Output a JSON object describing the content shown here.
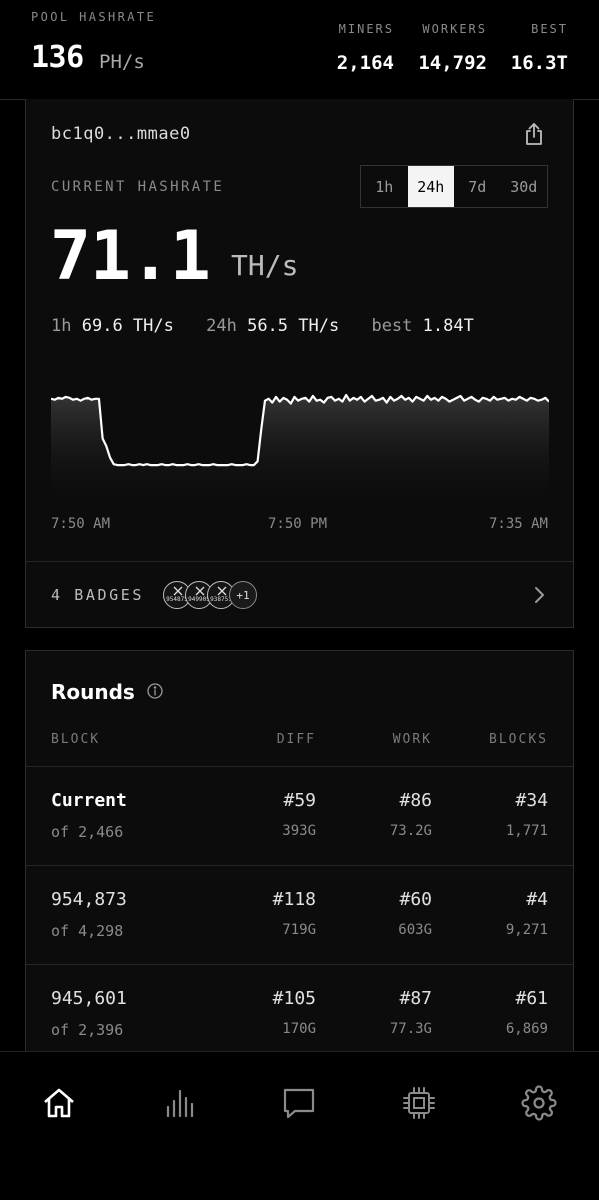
{
  "pool": {
    "label": "POOL HASHRATE",
    "value": "136",
    "unit": "PH/s",
    "stats": [
      {
        "label": "MINERS",
        "value": "2,164"
      },
      {
        "label": "WORKERS",
        "value": "14,792"
      },
      {
        "label": "BEST",
        "value": "16.3T"
      }
    ]
  },
  "miner": {
    "address": "bc1q0...mmae0",
    "share_icon": "share-icon",
    "current_label": "CURRENT HASHRATE",
    "ranges": [
      "1h",
      "24h",
      "7d",
      "30d"
    ],
    "active_range": "24h",
    "hashrate": "71.1",
    "hashrate_unit": "TH/s",
    "sub": {
      "h1_label": "1h",
      "h1_value": "69.6 TH/s",
      "h24_label": "24h",
      "h24_value": "56.5 TH/s",
      "best_label": "best",
      "best_value": "1.84T"
    },
    "badges": {
      "label": "4 BADGES",
      "items": [
        "954875",
        "949905",
        "938751"
      ],
      "more": "+1"
    }
  },
  "chart_data": {
    "type": "area",
    "x_tick_labels": [
      "7:50 AM",
      "7:50 PM",
      "7:35 AM"
    ],
    "values": [
      72,
      71,
      73,
      72,
      74,
      73,
      71,
      72,
      70,
      72,
      73,
      71,
      72,
      72,
      30,
      22,
      10,
      3,
      2,
      2,
      2,
      3,
      2,
      2,
      3,
      2,
      3,
      2,
      2,
      2,
      3,
      2,
      2,
      3,
      2,
      2,
      2,
      3,
      2,
      2,
      3,
      2,
      2,
      2,
      3,
      2,
      2,
      2,
      2,
      3,
      2,
      2,
      2,
      3,
      2,
      2,
      6,
      40,
      70,
      72,
      68,
      74,
      69,
      73,
      71,
      67,
      74,
      70,
      72,
      73,
      69,
      75,
      70,
      71,
      68,
      73,
      74,
      70,
      72,
      69,
      76,
      70,
      73,
      71,
      74,
      69,
      72,
      75,
      70,
      71,
      73,
      68,
      74,
      70,
      72,
      75,
      71,
      73,
      69,
      74,
      72,
      70,
      75,
      71,
      73,
      70,
      74,
      72,
      69,
      71,
      73,
      75,
      70,
      72,
      74,
      71,
      69,
      73,
      72,
      70,
      74,
      71,
      72,
      73,
      70,
      72,
      71,
      74,
      72,
      70,
      73,
      72,
      70,
      71,
      73,
      69
    ],
    "line_color": "#ffffff",
    "fill_color": "#3a3a3a"
  },
  "rounds": {
    "title": "Rounds",
    "info_icon": "info-icon",
    "headers": [
      "BLOCK",
      "DIFF",
      "WORK",
      "BLOCKS"
    ],
    "rows": [
      {
        "block": "Current",
        "of": "of 2,466",
        "diff": "#59",
        "diff_sub": "393G",
        "work": "#86",
        "work_sub": "73.2G",
        "blocks": "#34",
        "blocks_sub": "1,771"
      },
      {
        "block": "954,873",
        "of": "of 4,298",
        "diff": "#118",
        "diff_sub": "719G",
        "work": "#60",
        "work_sub": "603G",
        "blocks": "#4",
        "blocks_sub": "9,271"
      },
      {
        "block": "945,601",
        "of": "of 2,396",
        "diff": "#105",
        "diff_sub": "170G",
        "work": "#87",
        "work_sub": "77.3G",
        "blocks": "#61",
        "blocks_sub": "6,869"
      }
    ]
  },
  "nav": [
    "home-icon",
    "bar-chart-icon",
    "chat-icon",
    "chip-icon",
    "gear-icon"
  ]
}
